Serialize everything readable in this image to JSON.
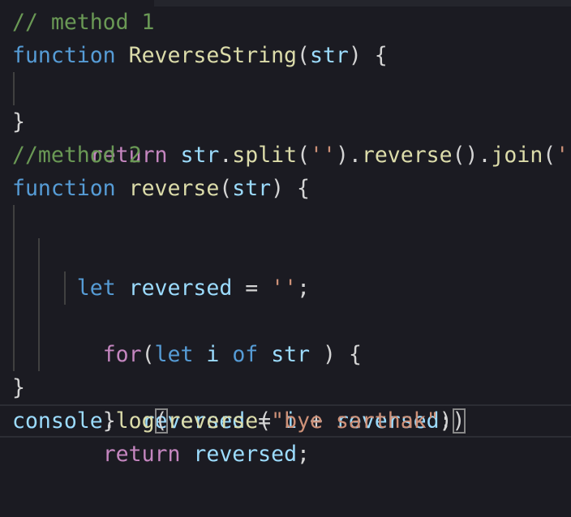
{
  "editor": {
    "lines": [
      {
        "tokens": [
          {
            "t": "// method 1",
            "c": "comment"
          }
        ]
      },
      {
        "tokens": [
          {
            "t": "function",
            "c": "keyword"
          },
          {
            "t": " ",
            "c": "punc"
          },
          {
            "t": "ReverseString",
            "c": "fn"
          },
          {
            "t": "(",
            "c": "punc"
          },
          {
            "t": "str",
            "c": "var"
          },
          {
            "t": ") {",
            "c": "punc"
          }
        ]
      },
      {
        "tokens": [
          {
            "t": "  ",
            "c": "punc"
          },
          {
            "t": "return",
            "c": "control"
          },
          {
            "t": " ",
            "c": "punc"
          },
          {
            "t": "str",
            "c": "var"
          },
          {
            "t": ".",
            "c": "punc"
          },
          {
            "t": "split",
            "c": "fn"
          },
          {
            "t": "(",
            "c": "punc"
          },
          {
            "t": "''",
            "c": "str"
          },
          {
            "t": ").",
            "c": "punc"
          },
          {
            "t": "reverse",
            "c": "fn"
          },
          {
            "t": "().",
            "c": "punc"
          },
          {
            "t": "join",
            "c": "fn"
          },
          {
            "t": "(",
            "c": "punc"
          },
          {
            "t": "''",
            "c": "str"
          },
          {
            "t": ")",
            "c": "punc"
          }
        ]
      },
      {
        "tokens": [
          {
            "t": "}",
            "c": "punc"
          }
        ]
      },
      {
        "tokens": [
          {
            "t": "//method 2",
            "c": "comment"
          }
        ]
      },
      {
        "tokens": [
          {
            "t": "function",
            "c": "keyword"
          },
          {
            "t": " ",
            "c": "punc"
          },
          {
            "t": "reverse",
            "c": "fn"
          },
          {
            "t": "(",
            "c": "punc"
          },
          {
            "t": "str",
            "c": "var"
          },
          {
            "t": ") {",
            "c": "punc"
          }
        ]
      },
      {
        "tokens": [
          {
            "t": " ",
            "c": "punc"
          },
          {
            "t": "let",
            "c": "keyword"
          },
          {
            "t": " ",
            "c": "punc"
          },
          {
            "t": "reversed",
            "c": "var"
          },
          {
            "t": " = ",
            "c": "punc"
          },
          {
            "t": "''",
            "c": "str"
          },
          {
            "t": ";",
            "c": "punc"
          }
        ]
      },
      {
        "tokens": [
          {
            "t": "   ",
            "c": "punc"
          },
          {
            "t": "for",
            "c": "control"
          },
          {
            "t": "(",
            "c": "punc"
          },
          {
            "t": "let",
            "c": "keyword"
          },
          {
            "t": " ",
            "c": "punc"
          },
          {
            "t": "i",
            "c": "var"
          },
          {
            "t": " ",
            "c": "punc"
          },
          {
            "t": "of",
            "c": "keyword"
          },
          {
            "t": " ",
            "c": "punc"
          },
          {
            "t": "str",
            "c": "var"
          },
          {
            "t": " ) {",
            "c": "punc"
          }
        ]
      },
      {
        "tokens": [
          {
            "t": "      ",
            "c": "punc"
          },
          {
            "t": "reversed",
            "c": "var"
          },
          {
            "t": " = ",
            "c": "punc"
          },
          {
            "t": "i",
            "c": "var"
          },
          {
            "t": " + ",
            "c": "punc"
          },
          {
            "t": "reversed",
            "c": "var"
          },
          {
            "t": ";",
            "c": "punc"
          }
        ]
      },
      {
        "tokens": [
          {
            "t": "   ",
            "c": "punc"
          },
          {
            "t": "}",
            "c": "punc"
          }
        ]
      },
      {
        "tokens": [
          {
            "t": "   ",
            "c": "punc"
          },
          {
            "t": "return",
            "c": "control"
          },
          {
            "t": " ",
            "c": "punc"
          },
          {
            "t": "reversed",
            "c": "var"
          },
          {
            "t": ";",
            "c": "punc"
          }
        ]
      },
      {
        "tokens": [
          {
            "t": "}",
            "c": "punc"
          }
        ]
      },
      {
        "tokens": [
          {
            "t": "console",
            "c": "console"
          },
          {
            "t": ".",
            "c": "punc"
          },
          {
            "t": "log",
            "c": "fn"
          },
          {
            "t": "(",
            "c": "punc",
            "m": true
          },
          {
            "t": "reverse",
            "c": "fn"
          },
          {
            "t": "(",
            "c": "punc"
          },
          {
            "t": "\"bye sarthak\"",
            "c": "str"
          },
          {
            "t": ")",
            "c": "punc"
          },
          {
            "t": ")",
            "c": "punc",
            "m": true
          }
        ],
        "current": true
      }
    ]
  },
  "colors": {
    "background": "#1b1b22",
    "comment": "#6a9955",
    "keyword": "#569cd6",
    "control": "#c586c0",
    "function": "#dcdcaa",
    "variable": "#9cdcfe",
    "string": "#ce9178",
    "punctuation": "#d4d4d4"
  }
}
